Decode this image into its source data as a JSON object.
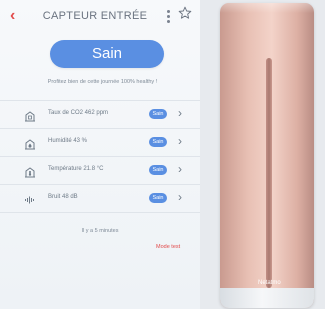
{
  "header": {
    "title": "CAPTEUR ENTRÉE",
    "back_icon": "chevron-left-icon",
    "more_icon": "more-vertical-icon",
    "favorite_icon": "star-outline-icon"
  },
  "status": {
    "label": "Sain",
    "tagline": "Profitez bien de cette journée 100% healthy !",
    "color": "#5a8fe2"
  },
  "measurements": [
    {
      "icon": "co2-icon",
      "label": "Taux de CO2 462 ppm",
      "badge": "Sain"
    },
    {
      "icon": "humidity-icon",
      "label": "Humidité 43 %",
      "badge": "Sain"
    },
    {
      "icon": "thermometer-icon",
      "label": "Température 21.8 °C",
      "badge": "Sain"
    },
    {
      "icon": "noise-icon",
      "label": "Bruit 48 dB",
      "badge": "Sain"
    }
  ],
  "updated": "Il y a 5 minutes",
  "mode_test": "Mode test",
  "device": {
    "brand": "Netatmo",
    "color": "#e8c0b4"
  }
}
